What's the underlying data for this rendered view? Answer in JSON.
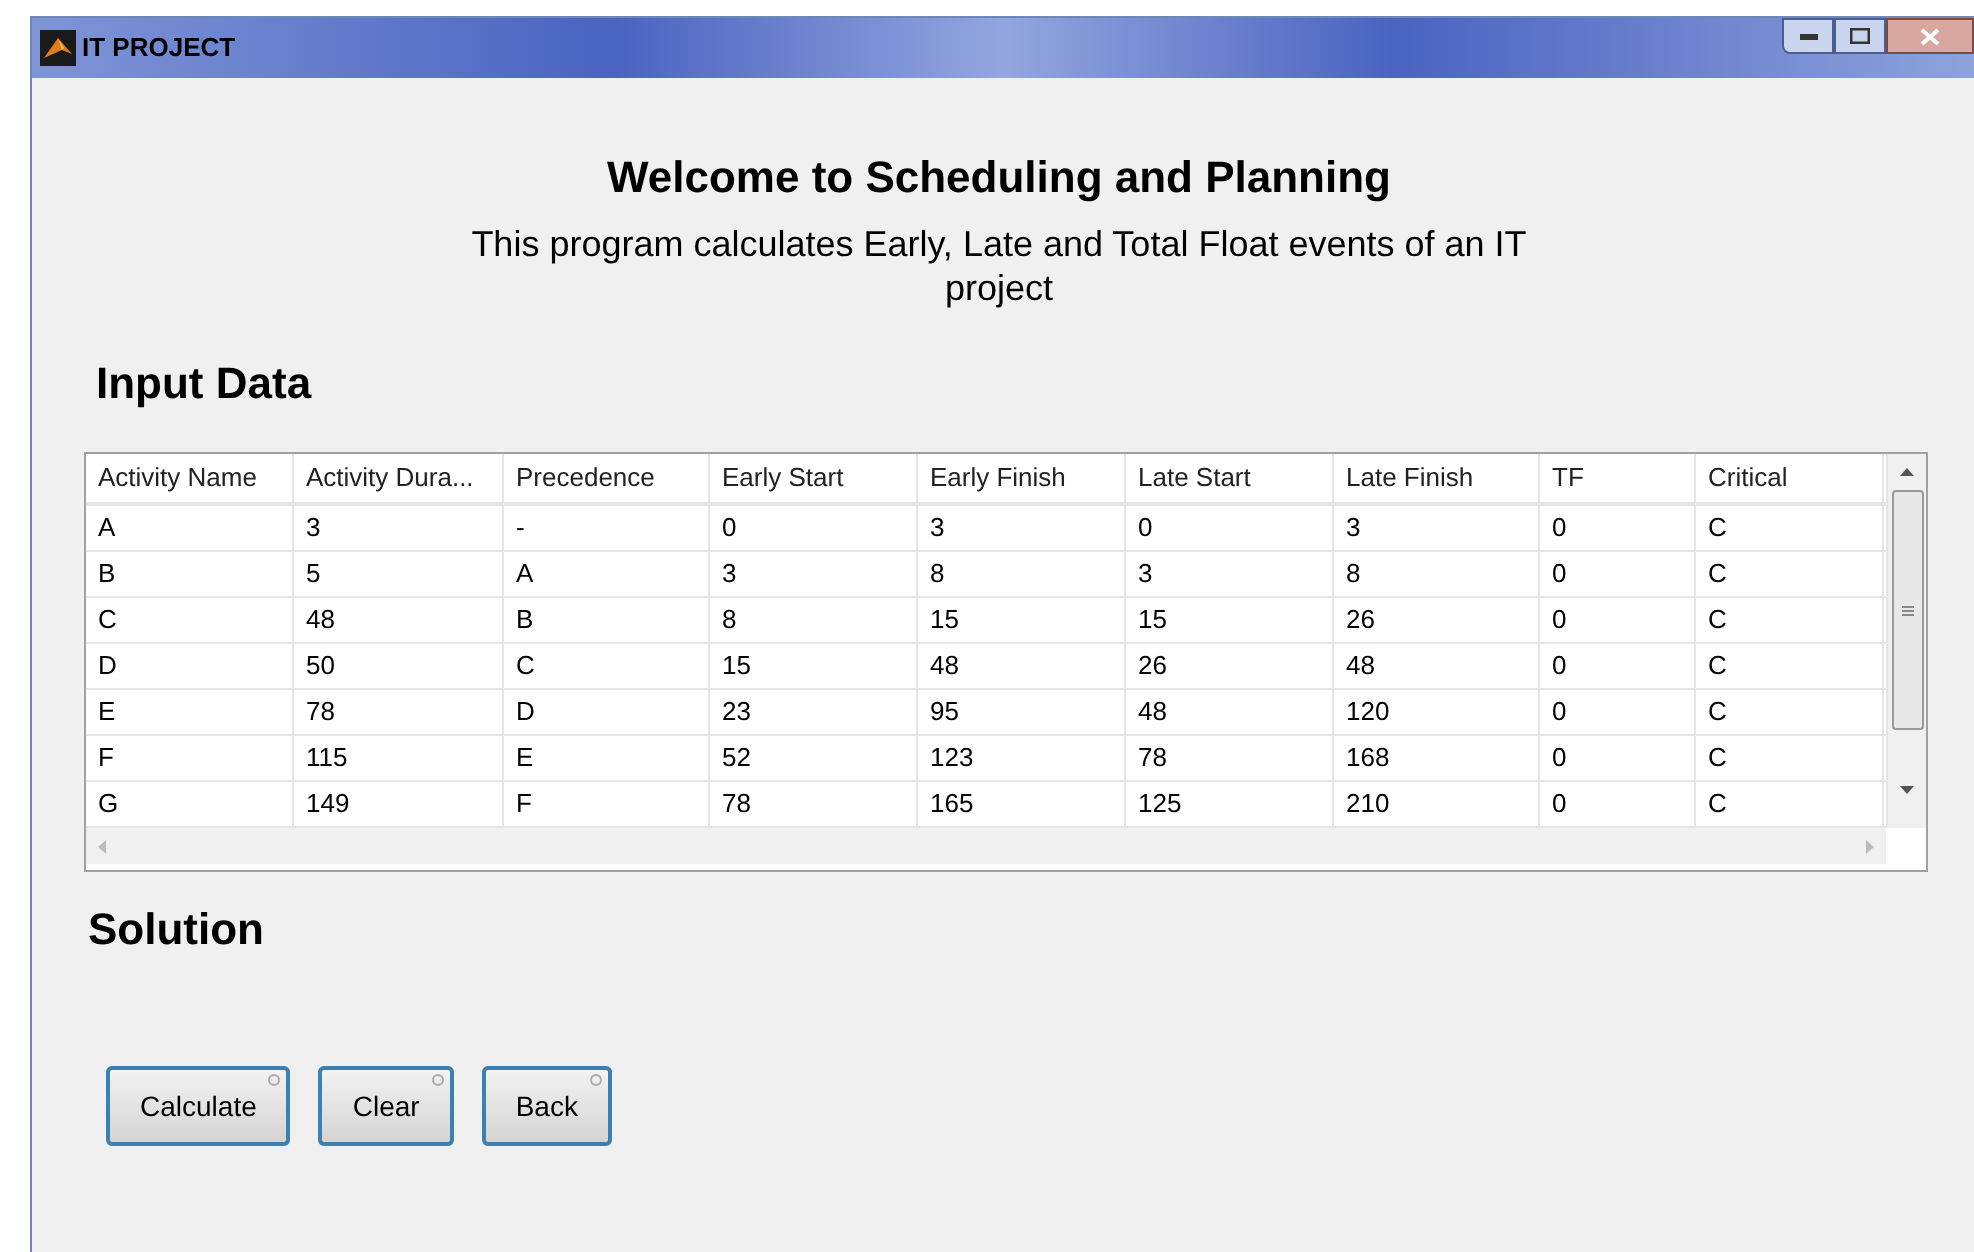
{
  "window": {
    "title": "IT PROJECT"
  },
  "heading": "Welcome to Scheduling and Planning",
  "description": "This program calculates Early, Late and Total Float events of an IT project",
  "input_section": "Input Data",
  "table": {
    "columns": [
      "Activity Name",
      "Activity Dura...",
      "Precedence",
      "Early Start",
      "Early Finish",
      "Late Start",
      "Late Finish",
      "TF",
      "Critical"
    ],
    "rows": [
      [
        "A",
        "3",
        "-",
        "0",
        "3",
        "0",
        "3",
        "0",
        "C"
      ],
      [
        "B",
        "5",
        "A",
        "3",
        "8",
        "3",
        "8",
        "0",
        "C"
      ],
      [
        "C",
        "48",
        "B",
        "8",
        "15",
        "15",
        "26",
        "0",
        "C"
      ],
      [
        "D",
        "50",
        "C",
        "15",
        "48",
        "26",
        "48",
        "0",
        "C"
      ],
      [
        "E",
        "78",
        "D",
        "23",
        "95",
        "48",
        "120",
        "0",
        "C"
      ],
      [
        "F",
        "115",
        "E",
        "52",
        "123",
        "78",
        "168",
        "0",
        "C"
      ],
      [
        "G",
        "149",
        "F",
        "78",
        "165",
        "125",
        "210",
        "0",
        "C"
      ]
    ]
  },
  "solution_section": "Solution",
  "buttons": [
    "Calculate",
    "Clear",
    "Back"
  ]
}
